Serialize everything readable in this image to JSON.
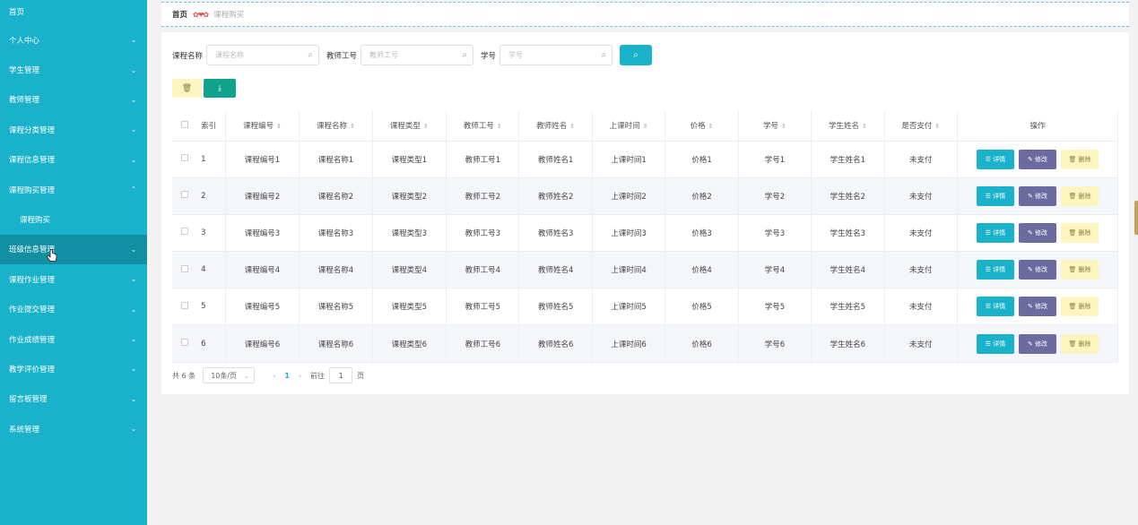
{
  "sidebar": {
    "items": [
      {
        "label": "首页",
        "chevron": ""
      },
      {
        "label": "个人中心",
        "chevron": "⌄"
      },
      {
        "label": "学生管理",
        "chevron": "⌄"
      },
      {
        "label": "教师管理",
        "chevron": "⌄"
      },
      {
        "label": "课程分类管理",
        "chevron": "⌄"
      },
      {
        "label": "课程信息管理",
        "chevron": "⌄"
      },
      {
        "label": "课程购买管理",
        "chevron": "⌃"
      },
      {
        "label": "课程购买",
        "chevron": ""
      },
      {
        "label": "班级信息管理",
        "chevron": "⌄"
      },
      {
        "label": "课程作业管理",
        "chevron": "⌄"
      },
      {
        "label": "作业提交管理",
        "chevron": "⌄"
      },
      {
        "label": "作业成绩管理",
        "chevron": "⌄"
      },
      {
        "label": "教学评价管理",
        "chevron": "⌄"
      },
      {
        "label": "留言板管理",
        "chevron": "⌄"
      },
      {
        "label": "系统管理",
        "chevron": "⌄"
      }
    ]
  },
  "breadcrumb": {
    "home": "首页",
    "sep": "✿❤✿",
    "current": "课程购买"
  },
  "search": {
    "course_name_label": "课程名称",
    "course_name_ph": "课程名称",
    "teacher_id_label": "教师工号",
    "teacher_id_ph": "教师工号",
    "student_id_label": "学号",
    "student_id_ph": "学号",
    "search_icon": "⌕"
  },
  "toolbar": {
    "delete_icon": "🗑",
    "export_icon": "⤓"
  },
  "table": {
    "headers": [
      "索引",
      "课程编号",
      "课程名称",
      "课程类型",
      "教师工号",
      "教师姓名",
      "上课时间",
      "价格",
      "学号",
      "学生姓名",
      "是否支付",
      "操作"
    ],
    "sort_icon": "⇕",
    "rows": [
      [
        "1",
        "课程编号1",
        "课程名称1",
        "课程类型1",
        "教师工号1",
        "教师姓名1",
        "上课时间1",
        "价格1",
        "学号1",
        "学生姓名1",
        "未支付"
      ],
      [
        "2",
        "课程编号2",
        "课程名称2",
        "课程类型2",
        "教师工号2",
        "教师姓名2",
        "上课时间2",
        "价格2",
        "学号2",
        "学生姓名2",
        "未支付"
      ],
      [
        "3",
        "课程编号3",
        "课程名称3",
        "课程类型3",
        "教师工号3",
        "教师姓名3",
        "上课时间3",
        "价格3",
        "学号3",
        "学生姓名3",
        "未支付"
      ],
      [
        "4",
        "课程编号4",
        "课程名称4",
        "课程类型4",
        "教师工号4",
        "教师姓名4",
        "上课时间4",
        "价格4",
        "学号4",
        "学生姓名4",
        "未支付"
      ],
      [
        "5",
        "课程编号5",
        "课程名称5",
        "课程类型5",
        "教师工号5",
        "教师姓名5",
        "上课时间5",
        "价格5",
        "学号5",
        "学生姓名5",
        "未支付"
      ],
      [
        "6",
        "课程编号6",
        "课程名称6",
        "课程类型6",
        "教师工号6",
        "教师姓名6",
        "上课时间6",
        "价格6",
        "学号6",
        "学生姓名6",
        "未支付"
      ]
    ],
    "op_detail": "☰ 详情",
    "op_edit": "✎ 修改",
    "op_delete": "🗑 删除"
  },
  "pager": {
    "total": "共 6 条",
    "size": "10条/页",
    "prev": "‹",
    "current": "1",
    "next": "›",
    "goto": "前往",
    "goto_value": "1",
    "page_unit": "页"
  },
  "colors": {
    "sidebar": "#19b2ca",
    "accent": "#19b2ca",
    "export": "#0fa38e",
    "edit": "#6c6ba0",
    "delete": "#fcf5c0"
  }
}
